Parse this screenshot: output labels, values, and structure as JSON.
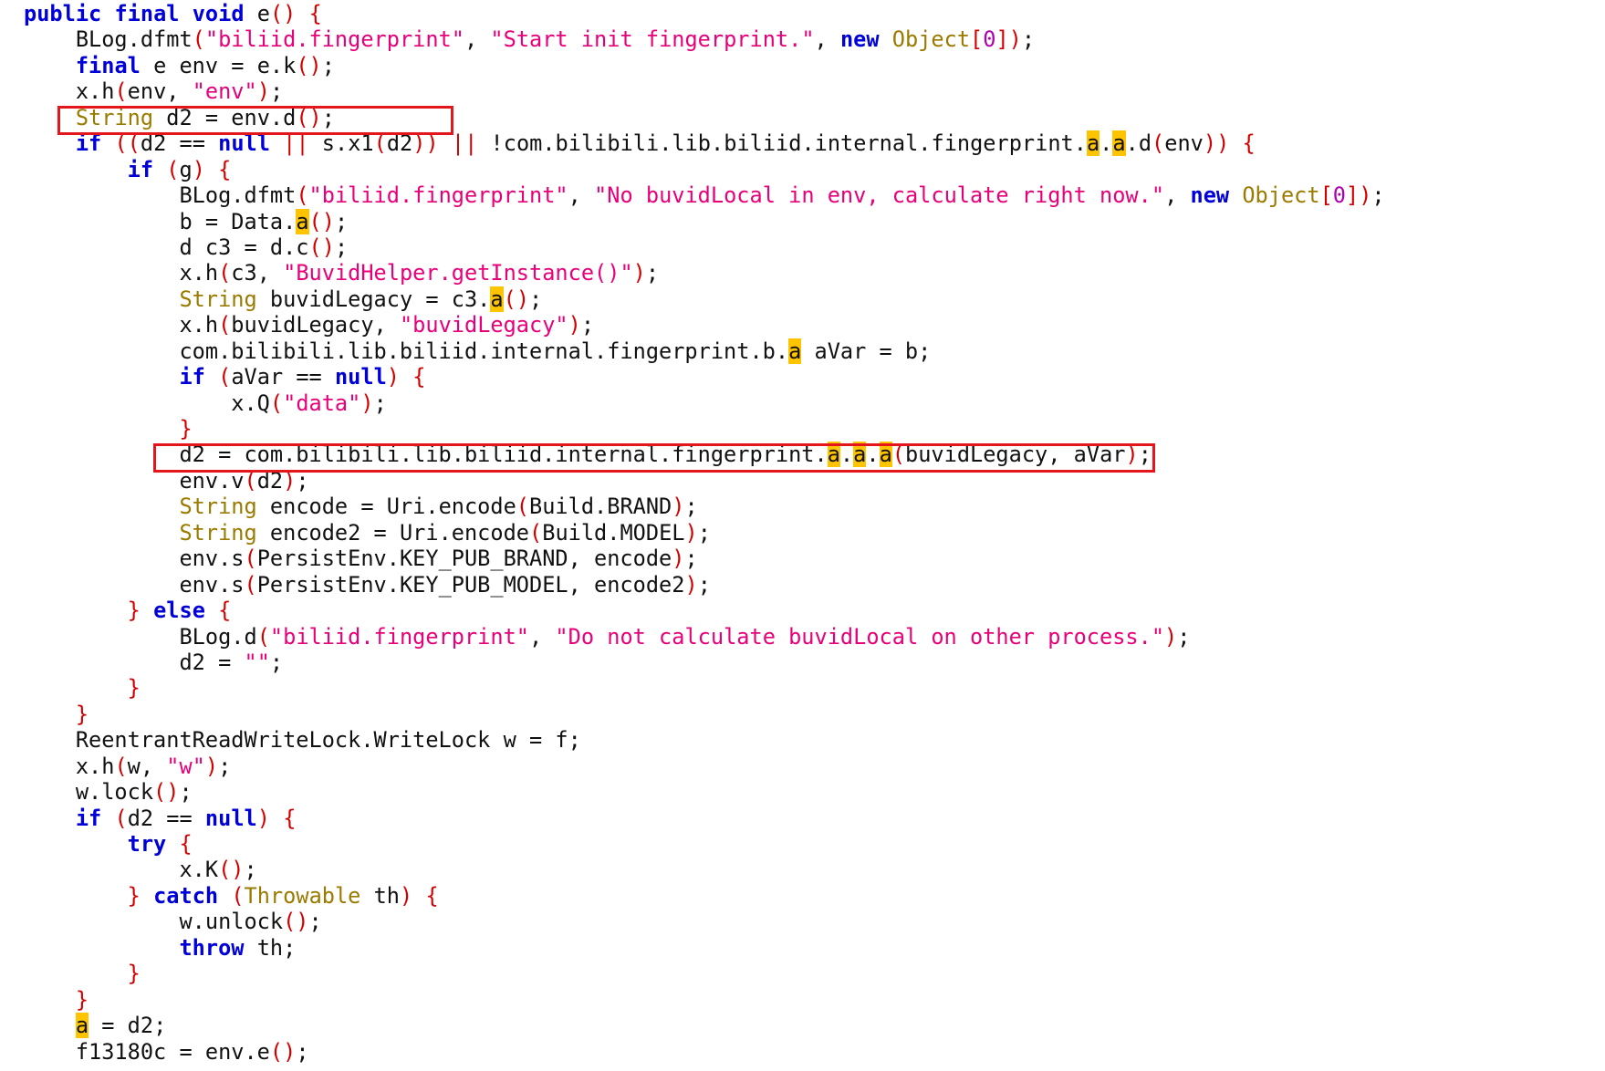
{
  "code": {
    "lines": [
      [
        [
          "kw",
          "public"
        ],
        [
          "p",
          " "
        ],
        [
          "kw",
          "final"
        ],
        [
          "p",
          " "
        ],
        [
          "kw",
          "void"
        ],
        [
          "p",
          " e"
        ],
        [
          "par",
          "()"
        ],
        [
          "p",
          " "
        ],
        [
          "par",
          "{"
        ]
      ],
      [
        [
          "p",
          "    BLog.dfmt"
        ],
        [
          "par",
          "("
        ],
        [
          "str",
          "\"biliid.fingerprint\""
        ],
        [
          "p",
          ", "
        ],
        [
          "str",
          "\"Start init fingerprint.\""
        ],
        [
          "p",
          ", "
        ],
        [
          "kw",
          "new"
        ],
        [
          "p",
          " "
        ],
        [
          "type",
          "Object"
        ],
        [
          "par",
          "["
        ],
        [
          "num",
          "0"
        ],
        [
          "par",
          "])"
        ],
        [
          "p",
          ";"
        ]
      ],
      [
        [
          "p",
          "    "
        ],
        [
          "kw",
          "final"
        ],
        [
          "p",
          " e env = e.k"
        ],
        [
          "par",
          "()"
        ],
        [
          "p",
          ";"
        ]
      ],
      [
        [
          "p",
          "    x.h"
        ],
        [
          "par",
          "("
        ],
        [
          "p",
          "env, "
        ],
        [
          "str",
          "\"env\""
        ],
        [
          "par",
          ")"
        ],
        [
          "p",
          ";"
        ]
      ],
      [
        [
          "p",
          "    "
        ],
        [
          "type",
          "String"
        ],
        [
          "p",
          " d2 = env.d"
        ],
        [
          "par",
          "()"
        ],
        [
          "p",
          ";"
        ]
      ],
      [
        [
          "p",
          "    "
        ],
        [
          "kw",
          "if"
        ],
        [
          "p",
          " "
        ],
        [
          "par",
          "(("
        ],
        [
          "p",
          "d2 == "
        ],
        [
          "kw",
          "null"
        ],
        [
          "p",
          " "
        ],
        [
          "par",
          "||"
        ],
        [
          "p",
          " s.x1"
        ],
        [
          "par",
          "("
        ],
        [
          "p",
          "d2"
        ],
        [
          "par",
          "))"
        ],
        [
          "p",
          " "
        ],
        [
          "par",
          "||"
        ],
        [
          "p",
          " !com.bilibili.lib.biliid.internal.fingerprint."
        ],
        [
          "hl",
          "a"
        ],
        [
          "p",
          "."
        ],
        [
          "hl",
          "a"
        ],
        [
          "p",
          ".d"
        ],
        [
          "par",
          "("
        ],
        [
          "p",
          "env"
        ],
        [
          "par",
          "))"
        ],
        [
          "p",
          " "
        ],
        [
          "par",
          "{"
        ]
      ],
      [
        [
          "p",
          "        "
        ],
        [
          "kw",
          "if"
        ],
        [
          "p",
          " "
        ],
        [
          "par",
          "("
        ],
        [
          "p",
          "g"
        ],
        [
          "par",
          ")"
        ],
        [
          "p",
          " "
        ],
        [
          "par",
          "{"
        ]
      ],
      [
        [
          "p",
          "            BLog.dfmt"
        ],
        [
          "par",
          "("
        ],
        [
          "str",
          "\"biliid.fingerprint\""
        ],
        [
          "p",
          ", "
        ],
        [
          "str",
          "\"No buvidLocal in env, calculate right now.\""
        ],
        [
          "p",
          ", "
        ],
        [
          "kw",
          "new"
        ],
        [
          "p",
          " "
        ],
        [
          "type",
          "Object"
        ],
        [
          "par",
          "["
        ],
        [
          "num",
          "0"
        ],
        [
          "par",
          "])"
        ],
        [
          "p",
          ";"
        ]
      ],
      [
        [
          "p",
          "            b = Data."
        ],
        [
          "hl",
          "a"
        ],
        [
          "par",
          "()"
        ],
        [
          "p",
          ";"
        ]
      ],
      [
        [
          "p",
          "            d c3 = d.c"
        ],
        [
          "par",
          "()"
        ],
        [
          "p",
          ";"
        ]
      ],
      [
        [
          "p",
          "            x.h"
        ],
        [
          "par",
          "("
        ],
        [
          "p",
          "c3, "
        ],
        [
          "str",
          "\"BuvidHelper.getInstance()\""
        ],
        [
          "par",
          ")"
        ],
        [
          "p",
          ";"
        ]
      ],
      [
        [
          "p",
          "            "
        ],
        [
          "type",
          "String"
        ],
        [
          "p",
          " buvidLegacy = c3."
        ],
        [
          "hl",
          "a"
        ],
        [
          "par",
          "()"
        ],
        [
          "p",
          ";"
        ]
      ],
      [
        [
          "p",
          "            x.h"
        ],
        [
          "par",
          "("
        ],
        [
          "p",
          "buvidLegacy, "
        ],
        [
          "str",
          "\"buvidLegacy\""
        ],
        [
          "par",
          ")"
        ],
        [
          "p",
          ";"
        ]
      ],
      [
        [
          "p",
          "            com.bilibili.lib.biliid.internal.fingerprint.b."
        ],
        [
          "hl",
          "a"
        ],
        [
          "p",
          " aVar = b;"
        ]
      ],
      [
        [
          "p",
          "            "
        ],
        [
          "kw",
          "if"
        ],
        [
          "p",
          " "
        ],
        [
          "par",
          "("
        ],
        [
          "p",
          "aVar == "
        ],
        [
          "kw",
          "null"
        ],
        [
          "par",
          ")"
        ],
        [
          "p",
          " "
        ],
        [
          "par",
          "{"
        ]
      ],
      [
        [
          "p",
          "                x.Q"
        ],
        [
          "par",
          "("
        ],
        [
          "str",
          "\"data\""
        ],
        [
          "par",
          ")"
        ],
        [
          "p",
          ";"
        ]
      ],
      [
        [
          "p",
          "            "
        ],
        [
          "par",
          "}"
        ]
      ],
      [
        [
          "p",
          "            d2 = com.bilibili.lib.biliid.internal.fingerprint."
        ],
        [
          "hl",
          "a"
        ],
        [
          "p",
          "."
        ],
        [
          "hl",
          "a"
        ],
        [
          "p",
          "."
        ],
        [
          "hl",
          "a"
        ],
        [
          "par",
          "("
        ],
        [
          "p",
          "buvidLegacy, aVar"
        ],
        [
          "par",
          ")"
        ],
        [
          "p",
          ";"
        ]
      ],
      [
        [
          "p",
          "            env.v"
        ],
        [
          "par",
          "("
        ],
        [
          "p",
          "d2"
        ],
        [
          "par",
          ")"
        ],
        [
          "p",
          ";"
        ]
      ],
      [
        [
          "p",
          "            "
        ],
        [
          "type",
          "String"
        ],
        [
          "p",
          " encode = Uri.encode"
        ],
        [
          "par",
          "("
        ],
        [
          "p",
          "Build.BRAND"
        ],
        [
          "par",
          ")"
        ],
        [
          "p",
          ";"
        ]
      ],
      [
        [
          "p",
          "            "
        ],
        [
          "type",
          "String"
        ],
        [
          "p",
          " encode2 = Uri.encode"
        ],
        [
          "par",
          "("
        ],
        [
          "p",
          "Build.MODEL"
        ],
        [
          "par",
          ")"
        ],
        [
          "p",
          ";"
        ]
      ],
      [
        [
          "p",
          "            env.s"
        ],
        [
          "par",
          "("
        ],
        [
          "p",
          "PersistEnv.KEY_PUB_BRAND, encode"
        ],
        [
          "par",
          ")"
        ],
        [
          "p",
          ";"
        ]
      ],
      [
        [
          "p",
          "            env.s"
        ],
        [
          "par",
          "("
        ],
        [
          "p",
          "PersistEnv.KEY_PUB_MODEL, encode2"
        ],
        [
          "par",
          ")"
        ],
        [
          "p",
          ";"
        ]
      ],
      [
        [
          "p",
          "        "
        ],
        [
          "par",
          "}"
        ],
        [
          "p",
          " "
        ],
        [
          "kw",
          "else"
        ],
        [
          "p",
          " "
        ],
        [
          "par",
          "{"
        ]
      ],
      [
        [
          "p",
          "            BLog.d"
        ],
        [
          "par",
          "("
        ],
        [
          "str",
          "\"biliid.fingerprint\""
        ],
        [
          "p",
          ", "
        ],
        [
          "str",
          "\"Do not calculate buvidLocal on other process.\""
        ],
        [
          "par",
          ")"
        ],
        [
          "p",
          ";"
        ]
      ],
      [
        [
          "p",
          "            d2 = "
        ],
        [
          "str",
          "\"\""
        ],
        [
          "p",
          ";"
        ]
      ],
      [
        [
          "p",
          "        "
        ],
        [
          "par",
          "}"
        ]
      ],
      [
        [
          "p",
          "    "
        ],
        [
          "par",
          "}"
        ]
      ],
      [
        [
          "p",
          "    ReentrantReadWriteLock.WriteLock w = f;"
        ]
      ],
      [
        [
          "p",
          "    x.h"
        ],
        [
          "par",
          "("
        ],
        [
          "p",
          "w, "
        ],
        [
          "str",
          "\"w\""
        ],
        [
          "par",
          ")"
        ],
        [
          "p",
          ";"
        ]
      ],
      [
        [
          "p",
          "    w.lock"
        ],
        [
          "par",
          "()"
        ],
        [
          "p",
          ";"
        ]
      ],
      [
        [
          "p",
          "    "
        ],
        [
          "kw",
          "if"
        ],
        [
          "p",
          " "
        ],
        [
          "par",
          "("
        ],
        [
          "p",
          "d2 == "
        ],
        [
          "kw",
          "null"
        ],
        [
          "par",
          ")"
        ],
        [
          "p",
          " "
        ],
        [
          "par",
          "{"
        ]
      ],
      [
        [
          "p",
          "        "
        ],
        [
          "kw",
          "try"
        ],
        [
          "p",
          " "
        ],
        [
          "par",
          "{"
        ]
      ],
      [
        [
          "p",
          "            x.K"
        ],
        [
          "par",
          "()"
        ],
        [
          "p",
          ";"
        ]
      ],
      [
        [
          "p",
          "        "
        ],
        [
          "par",
          "}"
        ],
        [
          "p",
          " "
        ],
        [
          "kw",
          "catch"
        ],
        [
          "p",
          " "
        ],
        [
          "par",
          "("
        ],
        [
          "type",
          "Throwable"
        ],
        [
          "p",
          " th"
        ],
        [
          "par",
          ")"
        ],
        [
          "p",
          " "
        ],
        [
          "par",
          "{"
        ]
      ],
      [
        [
          "p",
          "            w.unlock"
        ],
        [
          "par",
          "()"
        ],
        [
          "p",
          ";"
        ]
      ],
      [
        [
          "p",
          "            "
        ],
        [
          "kw",
          "throw"
        ],
        [
          "p",
          " th;"
        ]
      ],
      [
        [
          "p",
          "        "
        ],
        [
          "par",
          "}"
        ]
      ],
      [
        [
          "p",
          "    "
        ],
        [
          "par",
          "}"
        ]
      ],
      [
        [
          "p",
          "    "
        ],
        [
          "hl",
          "a"
        ],
        [
          "p",
          " = d2;"
        ]
      ],
      [
        [
          "p",
          "    f13180c = env.e"
        ],
        [
          "par",
          "()"
        ],
        [
          "p",
          ";"
        ]
      ]
    ]
  },
  "annotations": {
    "boxed_lines": [
      5,
      18
    ],
    "box_color": "#e5151c"
  },
  "colors": {
    "keyword": "#0000d8",
    "type": "#9a7b00",
    "string": "#e8007a",
    "paren": "#d40000",
    "number": "#b000b0",
    "highlight": "#ffc400"
  }
}
